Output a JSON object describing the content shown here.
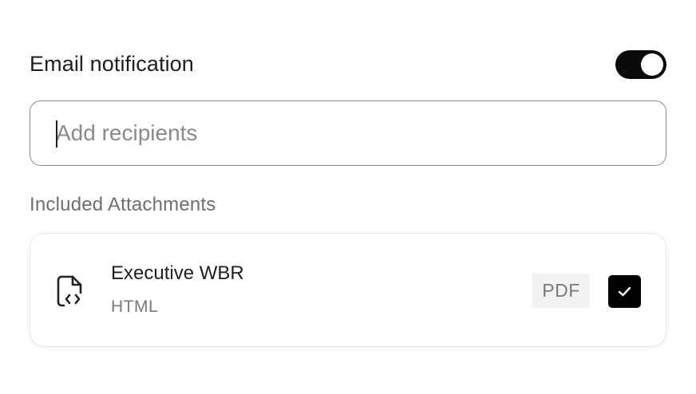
{
  "email_notification": {
    "title": "Email notification",
    "toggle_on": true
  },
  "recipients": {
    "placeholder": "Add recipients",
    "value": ""
  },
  "attachments": {
    "section_label": "Included Attachments",
    "items": [
      {
        "name": "Executive WBR",
        "type": "HTML",
        "icon": "file-code-icon",
        "format_badge": "PDF",
        "checked": true
      }
    ]
  },
  "colors": {
    "toggle_on": "#0a0a0a",
    "checkbox": "#000000",
    "badge_bg": "#f2f2f2"
  }
}
